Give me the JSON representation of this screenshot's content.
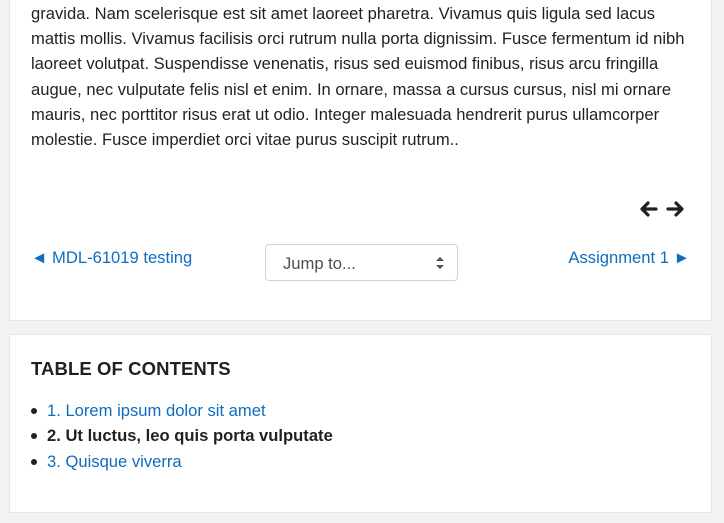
{
  "content": {
    "paragraph": "gravida. Nam scelerisque est sit amet laoreet pharetra. Vivamus quis ligula sed lacus mattis mollis. Vivamus facilisis orci rutrum nulla porta dignissim. Fusce fermentum id nibh laoreet volutpat. Suspendisse venenatis, risus sed euismod finibus, risus arcu fringilla augue, nec vulputate felis nisl et enim. In ornare, massa a cursus cursus, nisl mi ornare mauris, nec porttitor risus erat ut odio. Integer malesuada hendrerit purus ullamcorper molestie. Fusce imperdiet orci vitae purus suscipit rutrum.."
  },
  "page_nav": {
    "prev_icon": "arrow-left-icon",
    "next_icon": "arrow-right-icon"
  },
  "activity_nav": {
    "prev_label": "◄ MDL-61019 testing",
    "jump_placeholder": "Jump to...",
    "next_label": "Assignment 1 ►"
  },
  "toc": {
    "title": "TABLE OF CONTENTS",
    "items": [
      {
        "label": "1. Lorem ipsum dolor sit amet",
        "current": false
      },
      {
        "label": "2. Ut luctus, leo quis porta vulputate",
        "current": true
      },
      {
        "label": "3. Quisque viverra",
        "current": false
      }
    ]
  },
  "colors": {
    "link": "#0f6cbf",
    "text": "#1d2125",
    "page_bg": "#f2f2f2"
  }
}
